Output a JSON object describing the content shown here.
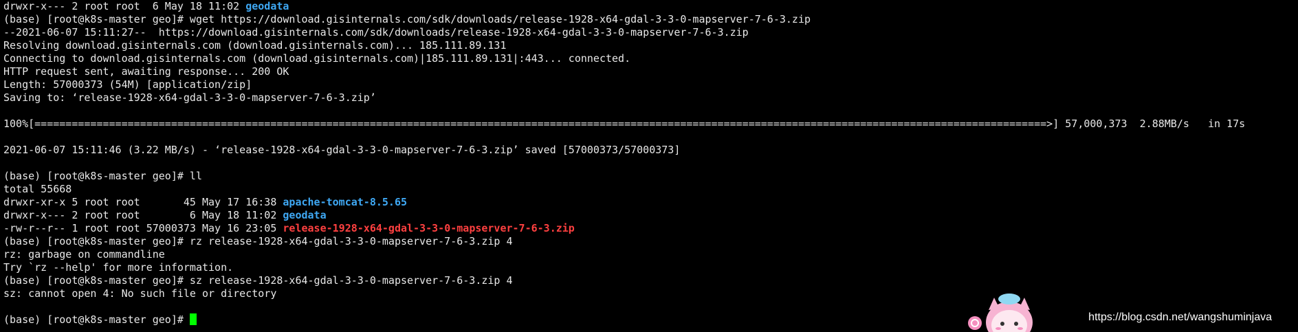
{
  "watermark": "https://blog.csdn.net/wangshuminjava",
  "lines": {
    "l0": {
      "a": "drwxr-x--- 2 root root  6 May 18 11:02 ",
      "b": "geodata"
    },
    "l1": "(base) [root@k8s-master geo]# wget https://download.gisinternals.com/sdk/downloads/release-1928-x64-gdal-3-3-0-mapserver-7-6-3.zip",
    "l2": "--2021-06-07 15:11:27--  https://download.gisinternals.com/sdk/downloads/release-1928-x64-gdal-3-3-0-mapserver-7-6-3.zip",
    "l3": "Resolving download.gisinternals.com (download.gisinternals.com)... 185.111.89.131",
    "l4": "Connecting to download.gisinternals.com (download.gisinternals.com)|185.111.89.131|:443... connected.",
    "l5": "HTTP request sent, awaiting response... 200 OK",
    "l6": "Length: 57000373 (54M) [application/zip]",
    "l7": "Saving to: ‘release-1928-x64-gdal-3-3-0-mapserver-7-6-3.zip’",
    "l8": "",
    "l9": "100%[===================================================================================================================================================================>] 57,000,373  2.88MB/s   in 17s",
    "l10": "",
    "l11": "2021-06-07 15:11:46 (3.22 MB/s) - ‘release-1928-x64-gdal-3-3-0-mapserver-7-6-3.zip’ saved [57000373/57000373]",
    "l12": "",
    "l13": "(base) [root@k8s-master geo]# ll",
    "l14": "total 55668",
    "l15": {
      "a": "drwxr-xr-x 5 root root       45 May 17 16:38 ",
      "b": "apache-tomcat-8.5.65"
    },
    "l16": {
      "a": "drwxr-x--- 2 root root        6 May 18 11:02 ",
      "b": "geodata"
    },
    "l17": {
      "a": "-rw-r--r-- 1 root root 57000373 May 16 23:05 ",
      "b": "release-1928-x64-gdal-3-3-0-mapserver-7-6-3.zip"
    },
    "l18": "(base) [root@k8s-master geo]# rz release-1928-x64-gdal-3-3-0-mapserver-7-6-3.zip 4",
    "l19": "rz: garbage on commandline",
    "l20": "Try `rz --help' for more information.",
    "l21": "(base) [root@k8s-master geo]# sz release-1928-x64-gdal-3-3-0-mapserver-7-6-3.zip 4",
    "l22": "sz: cannot open 4: No such file or directory",
    "l23": "",
    "l24": "(base) [root@k8s-master geo]# "
  },
  "colors": {
    "background": "#000000",
    "text": "#e8e8e8",
    "directory": "#3fa9f5",
    "archive": "#ff4040",
    "cursor": "#00ff00"
  },
  "icons": [
    "cursor-block",
    "mascot-image"
  ]
}
